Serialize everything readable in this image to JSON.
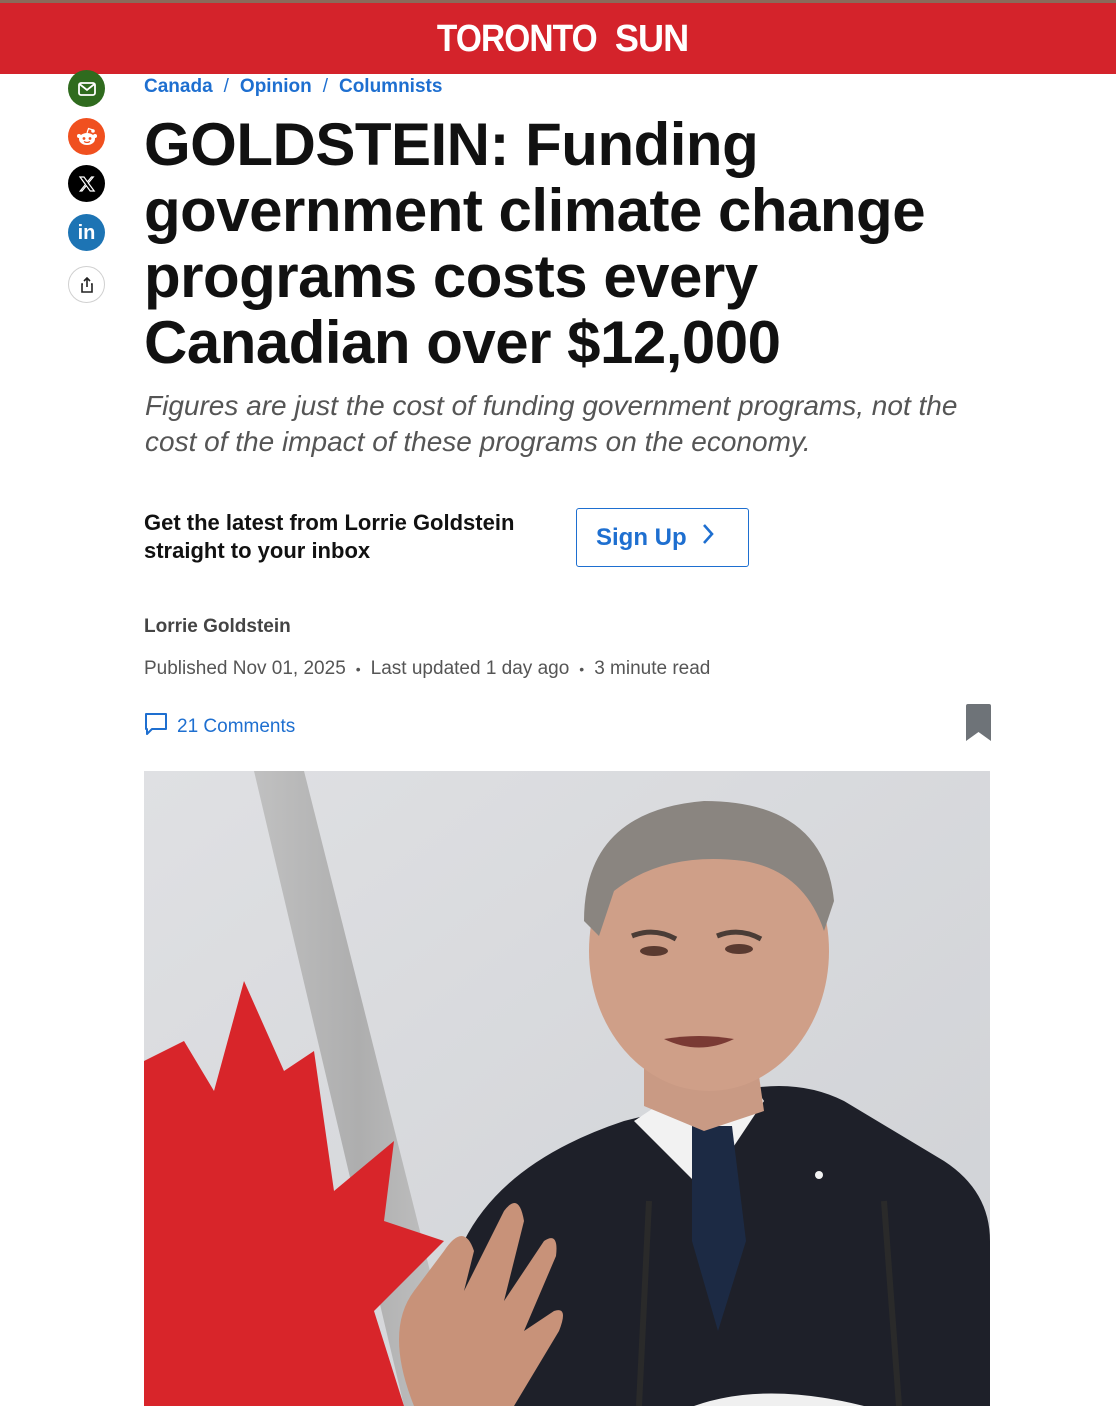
{
  "brand": {
    "name_part1": "TORONTO",
    "name_part2": "SUN",
    "color": "#d4232b"
  },
  "share_rail": [
    {
      "name": "email-icon",
      "color": "#2f6b1e"
    },
    {
      "name": "reddit-icon",
      "color": "#f0501f"
    },
    {
      "name": "x-icon",
      "color": "#000000"
    },
    {
      "name": "linkedin-icon",
      "color": "#1d74b4",
      "glyph": "in"
    },
    {
      "name": "share-icon",
      "color": "#ffffff"
    }
  ],
  "breadcrumb": {
    "items": [
      "Canada",
      "Opinion",
      "Columnists"
    ],
    "separator": "/"
  },
  "article": {
    "headline": "GOLDSTEIN: Funding government climate change programs costs every Canadian over $12,000",
    "deck": "Figures are just the cost of funding government programs, not the cost of the impact of these programs on the economy.",
    "author": "Lorrie Goldstein",
    "published": "Published Nov 01, 2025",
    "updated": "Last updated 1 day ago",
    "read_time": "3 minute read",
    "comments_label": "21 Comments"
  },
  "newsletter": {
    "text_line1": "Get the latest from Lorrie Goldstein",
    "text_line2": "straight to your inbox",
    "button_label": "Sign Up"
  },
  "colors": {
    "accent_blue": "#1e6fd0",
    "headline": "#111111",
    "deck": "#555555"
  }
}
